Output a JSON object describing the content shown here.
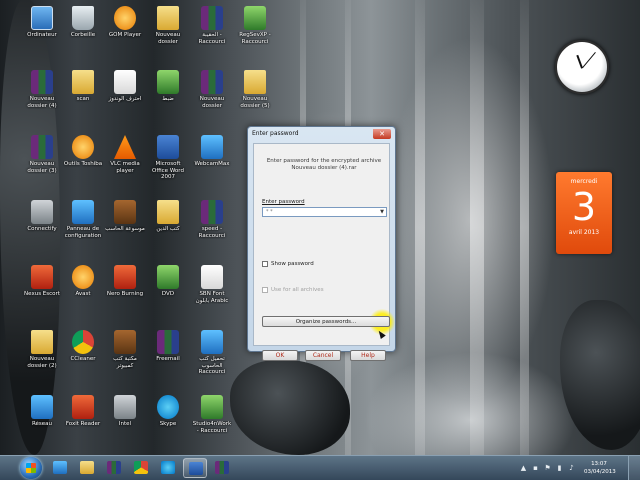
{
  "desktop": {
    "icons": [
      {
        "label": "Ordinateur",
        "icon": "computer-icon"
      },
      {
        "label": "Corbeille",
        "icon": "recycle-bin-icon"
      },
      {
        "label": "GOM Player",
        "icon": "gom-player-icon"
      },
      {
        "label": "Nouveau dossier",
        "icon": "folder-icon"
      },
      {
        "label": "الحقيبة - Raccourci",
        "icon": "winrar-archive-icon"
      },
      {
        "label": "RegSevXP - Raccourci",
        "icon": "program-icon"
      },
      {
        "label": "Nouveau dossier (4)",
        "icon": "winrar-archive-icon"
      },
      {
        "label": "scan",
        "icon": "folder-icon"
      },
      {
        "label": "احترف الوندوز",
        "icon": "document-icon"
      },
      {
        "label": "ضبط",
        "icon": "program-icon"
      },
      {
        "label": "Nouveau dossier",
        "icon": "winrar-archive-icon"
      },
      {
        "label": "Nouveau dossier (5)",
        "icon": "folder-icon"
      },
      {
        "label": "Nouveau dossier (3)",
        "icon": "winrar-archive-icon"
      },
      {
        "label": "Outils Toshiba",
        "icon": "star-icon"
      },
      {
        "label": "VLC media player",
        "icon": "vlc-icon"
      },
      {
        "label": "Microsoft Office Word 2007",
        "icon": "word-icon"
      },
      {
        "label": "WebcamMax",
        "icon": "webcam-icon"
      },
      {
        "label": "Connectify",
        "icon": "wifi-icon"
      },
      {
        "label": "Panneau de configuration",
        "icon": "control-panel-icon"
      },
      {
        "label": "موسوعة الحاسب",
        "icon": "book-icon"
      },
      {
        "label": "كتب الدين",
        "icon": "folder-icon"
      },
      {
        "label": "speed - Raccourci",
        "icon": "winrar-archive-icon"
      },
      {
        "label": "Nexus Escort",
        "icon": "nexus-icon"
      },
      {
        "label": "Avast",
        "icon": "avast-icon"
      },
      {
        "label": "Nero Burning",
        "icon": "nero-icon"
      },
      {
        "label": "DVD",
        "icon": "dvd-icon"
      },
      {
        "label": "SBN Font بابلون Arabic",
        "icon": "document-icon"
      },
      {
        "label": "Nouveau dossier (2)",
        "icon": "folder-icon"
      },
      {
        "label": "CCleaner",
        "icon": "ccleaner-icon"
      },
      {
        "label": "مكتبة كتب كمبيوتر",
        "icon": "book-icon"
      },
      {
        "label": "Freemail",
        "icon": "winrar-archive-icon"
      },
      {
        "label": "تحميل كتب الحاسوب Raccourci",
        "icon": "program-icon"
      },
      {
        "label": "Réseau",
        "icon": "network-icon"
      },
      {
        "label": "Foxit Reader",
        "icon": "foxit-icon"
      },
      {
        "label": "Intel",
        "icon": "user-icon"
      },
      {
        "label": "Skype",
        "icon": "skype-icon"
      },
      {
        "label": "Studio4nWork - Raccourci",
        "icon": "program-icon"
      }
    ]
  },
  "gadgets": {
    "calendar": {
      "weekday": "mercredi",
      "day": "3",
      "month": "avril 2013"
    },
    "clock": {
      "label": "clock-gadget"
    }
  },
  "dialog": {
    "title": "Enter password",
    "close": "✕",
    "info_line1": "Enter password for the encrypted archive",
    "info_line2": "Nouveau dossier (4).rar",
    "password_label": "Enter password",
    "password_value": "* *",
    "show_password": "Show password",
    "use_for_all": "Use for all archives",
    "organize": "Organize passwords...",
    "ok": "OK",
    "cancel": "Cancel",
    "help": "Help"
  },
  "taskbar": {
    "time": "13:07",
    "date": "03/04/2013",
    "apps": [
      "windows-explorer-icon",
      "internet-explorer-icon",
      "file-explorer-icon",
      "winrar-icon",
      "chrome-icon",
      "skype-icon",
      "powerpoint-icon",
      "winrar-archive-icon"
    ]
  },
  "colors": {
    "calendar": "#e04a0c",
    "dialog_bg": "#c4d6e8",
    "highlight": "#ffee00",
    "taskbar": "#34475a"
  }
}
